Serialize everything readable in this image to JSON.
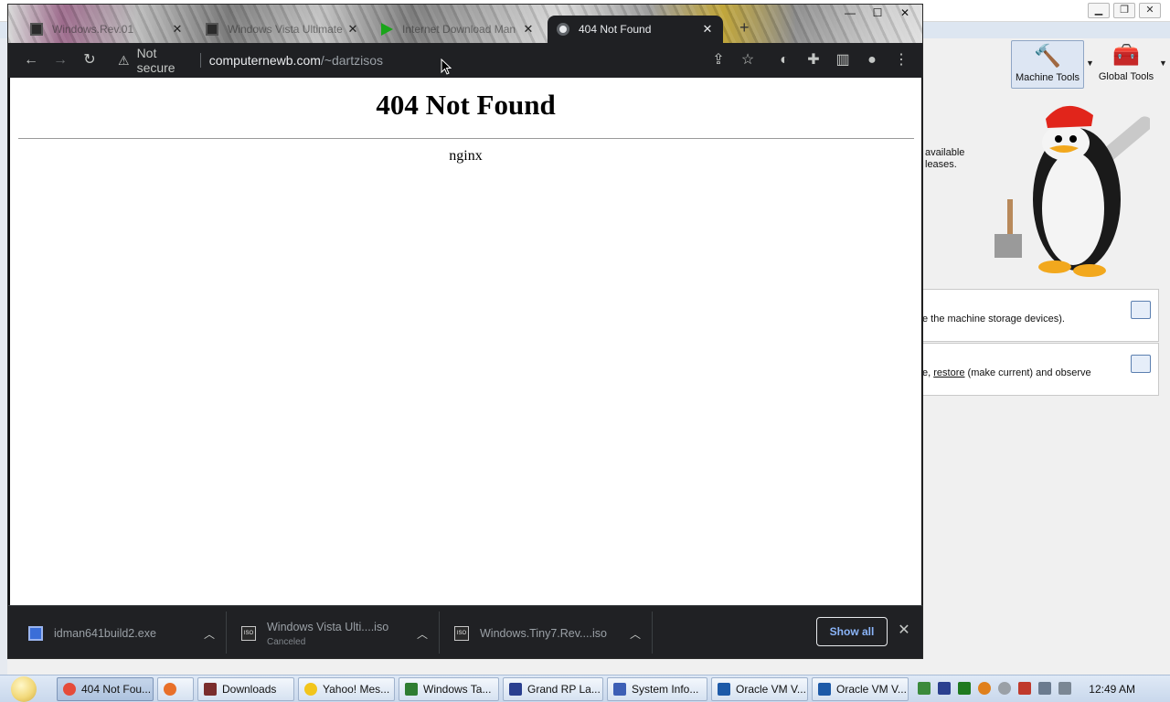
{
  "virtualbox": {
    "tools": {
      "machine_tools_label": "Machine Tools",
      "global_tools_label": "Global Tools"
    },
    "welcome_fragments": {
      "line1": "available",
      "line2": "leases."
    },
    "card_media": {
      "text": "e the machine storage devices)."
    },
    "card_snapshots": {
      "text_before": "e, ",
      "link": "restore",
      "text_after": " (make current) and observe"
    }
  },
  "chrome": {
    "tabs": [
      {
        "title": "Windows.Rev.01",
        "icon": "archive-icon"
      },
      {
        "title": "Windows Vista Ultimate",
        "icon": "archive-icon"
      },
      {
        "title": "Internet Download Man",
        "icon": "play-icon"
      },
      {
        "title": "404 Not Found",
        "icon": "globe-icon",
        "active": true
      }
    ],
    "newtab_label": "+",
    "omnibox": {
      "security": "Not secure",
      "host": "computernewb.com",
      "path": "/~dartzisos"
    },
    "page": {
      "heading": "404 Not Found",
      "server": "nginx"
    },
    "downloads": [
      {
        "name": "idman641build2.exe",
        "status": ""
      },
      {
        "name": "Windows Vista Ulti....iso",
        "status": "Canceled"
      },
      {
        "name": "Windows.Tiny7.Rev....iso",
        "status": ""
      }
    ],
    "show_all": "Show all"
  },
  "taskbar": {
    "items": [
      {
        "label": "404 Not Fou...",
        "color": "#e54b3a",
        "active": true
      },
      {
        "label": "",
        "color": "#e8702a"
      },
      {
        "label": "Downloads",
        "color": "#7a2d2d"
      },
      {
        "label": "Yahoo! Mes...",
        "color": "#f2c51c"
      },
      {
        "label": "Windows Ta...",
        "color": "#2f7d32"
      },
      {
        "label": "Grand RP La...",
        "color": "#2a3f8f"
      },
      {
        "label": "System Info...",
        "color": "#3d5fb5"
      },
      {
        "label": "Oracle VM V...",
        "color": "#1d5aa8"
      },
      {
        "label": "Oracle VM V...",
        "color": "#1d5aa8"
      }
    ],
    "clock": "12:49 AM"
  }
}
